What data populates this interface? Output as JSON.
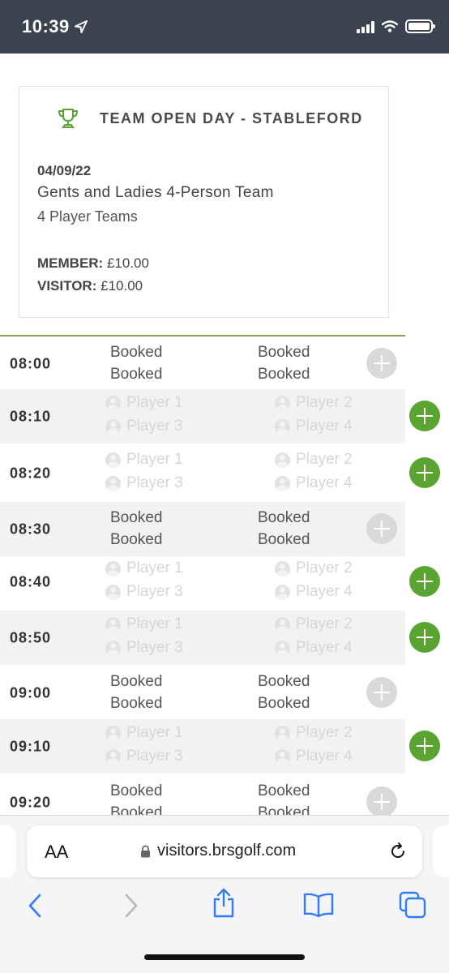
{
  "status_bar": {
    "time": "10:39"
  },
  "event": {
    "title": "TEAM OPEN DAY - STABLEFORD",
    "date": "04/09/22",
    "description": "Gents and Ladies 4-Person Team",
    "team_size": "4 Player Teams",
    "member_label": "MEMBER:",
    "member_price": "£10.00",
    "visitor_label": "VISITOR:",
    "visitor_price": "£10.00"
  },
  "slots": [
    {
      "time": "08:00",
      "status": "booked",
      "cells": [
        "Booked",
        "Booked",
        "Booked",
        "Booked"
      ]
    },
    {
      "time": "08:10",
      "status": "available",
      "cells": [
        "Player 1",
        "Player 2",
        "Player 3",
        "Player 4"
      ]
    },
    {
      "time": "08:20",
      "status": "available",
      "cells": [
        "Player 1",
        "Player 2",
        "Player 3",
        "Player 4"
      ]
    },
    {
      "time": "08:30",
      "status": "booked",
      "cells": [
        "Booked",
        "Booked",
        "Booked",
        "Booked"
      ]
    },
    {
      "time": "08:40",
      "status": "available",
      "cells": [
        "Player 1",
        "Player 2",
        "Player 3",
        "Player 4"
      ]
    },
    {
      "time": "08:50",
      "status": "available",
      "cells": [
        "Player 1",
        "Player 2",
        "Player 3",
        "Player 4"
      ]
    },
    {
      "time": "09:00",
      "status": "booked",
      "cells": [
        "Booked",
        "Booked",
        "Booked",
        "Booked"
      ]
    },
    {
      "time": "09:10",
      "status": "available",
      "cells": [
        "Player 1",
        "Player 2",
        "Player 3",
        "Player 4"
      ]
    },
    {
      "time": "09:20",
      "status": "booked",
      "cells": [
        "Booked",
        "Booked",
        "Booked",
        "Booked"
      ]
    }
  ],
  "browser": {
    "text_size_label": "AA",
    "url": "visitors.brsgolf.com"
  },
  "colors": {
    "status_bar_bg": "#3b4350",
    "accent_green": "#5aa531",
    "divider_green": "#7ba65a",
    "ios_blue": "#2f7cf6"
  }
}
